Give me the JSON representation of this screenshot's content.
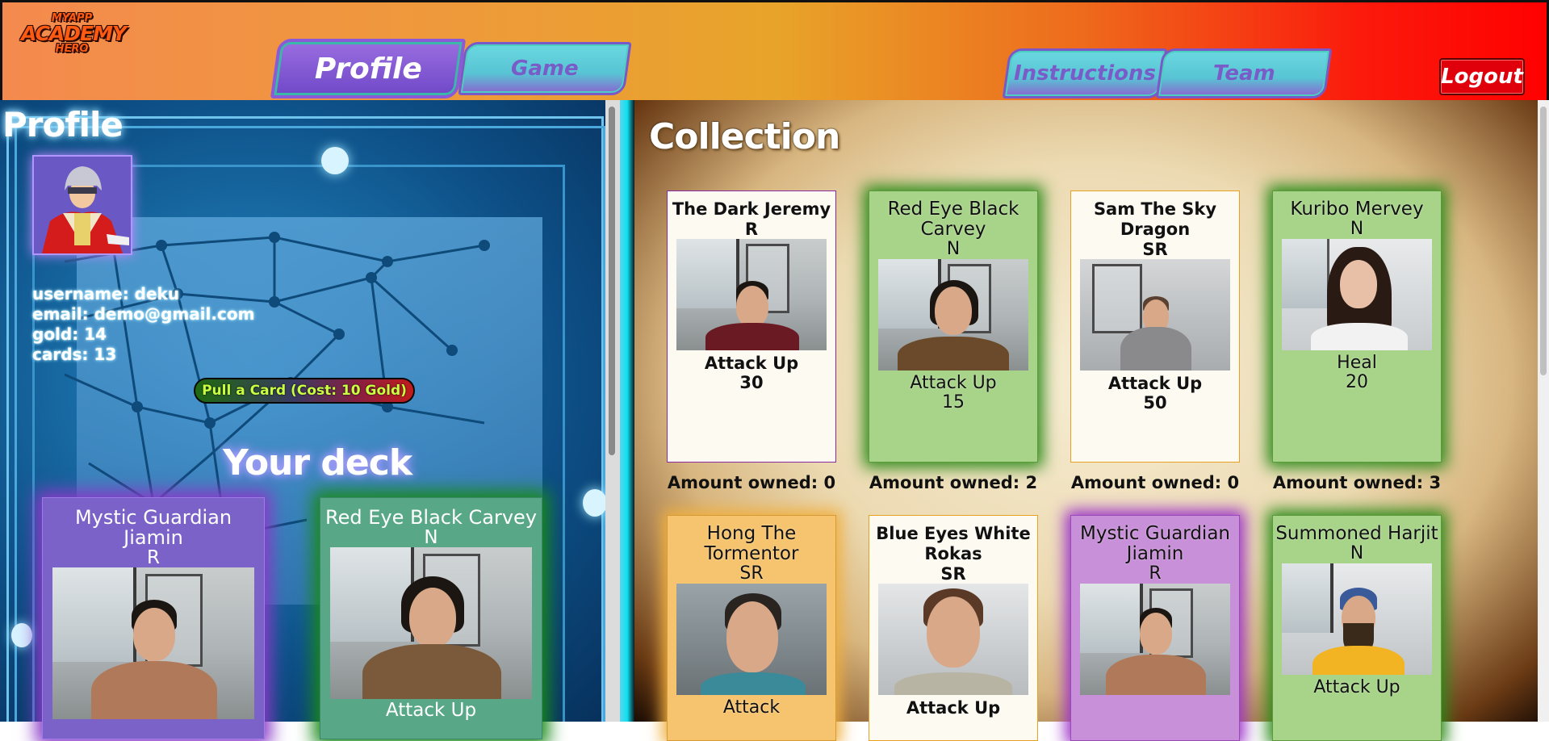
{
  "app": {
    "logo": {
      "line1": "MYAPP",
      "line2": "ACADEMY",
      "line3": "HERO"
    },
    "nav": {
      "profile": "Profile",
      "game": "Game",
      "instructions": "Instructions",
      "team": "Team",
      "logout": "Logout"
    }
  },
  "profile": {
    "title": "Profile",
    "username_label": "username: deku",
    "email_label": "email: demo@gmail.com",
    "gold_label": "gold: 14",
    "cards_label": "cards: 13",
    "pull_button": "Pull a Card (Cost: 10 Gold)",
    "deck_title": "Your deck",
    "deck": [
      {
        "name": "Mystic Guardian Jiamin",
        "rarity": "R",
        "ability": ""
      },
      {
        "name": "Red Eye Black Carvey",
        "rarity": "N",
        "ability": "Attack Up"
      }
    ]
  },
  "collection": {
    "title": "Collection",
    "cards": [
      {
        "name": "The Dark Jeremy",
        "rarity": "R",
        "ability": "Attack Up",
        "power": "30",
        "owned": "Amount owned: 0"
      },
      {
        "name": "Red Eye Black Carvey",
        "rarity": "N",
        "ability": "Attack Up",
        "power": "15",
        "owned": "Amount owned: 2"
      },
      {
        "name": "Sam The Sky Dragon",
        "rarity": "SR",
        "ability": "Attack Up",
        "power": "50",
        "owned": "Amount owned: 0"
      },
      {
        "name": "Kuribo Mervey",
        "rarity": "N",
        "ability": "Heal",
        "power": "20",
        "owned": "Amount owned: 3"
      },
      {
        "name": "Hong The Tormentor",
        "rarity": "SR",
        "ability": "Attack",
        "power": ""
      },
      {
        "name": "Blue Eyes White Rokas",
        "rarity": "SR",
        "ability": "Attack Up",
        "power": ""
      },
      {
        "name": "Mystic Guardian Jiamin",
        "rarity": "R",
        "ability": "",
        "power": ""
      },
      {
        "name": "Summoned Harjit",
        "rarity": "N",
        "ability": "Attack Up",
        "power": ""
      }
    ]
  },
  "colors": {
    "header_left": "#f48a4e",
    "header_right": "#ff0000",
    "tab_cyan": "#58c4d4",
    "tab_purple": "#7a58c8",
    "logout_red": "#e0000c",
    "rarity_n_glow": "#2a8a18",
    "rarity_r_glow": "#9a30c8",
    "rarity_sr_glow": "#f0b040"
  },
  "icons": {
    "avatar": "anime-character-avatar"
  }
}
